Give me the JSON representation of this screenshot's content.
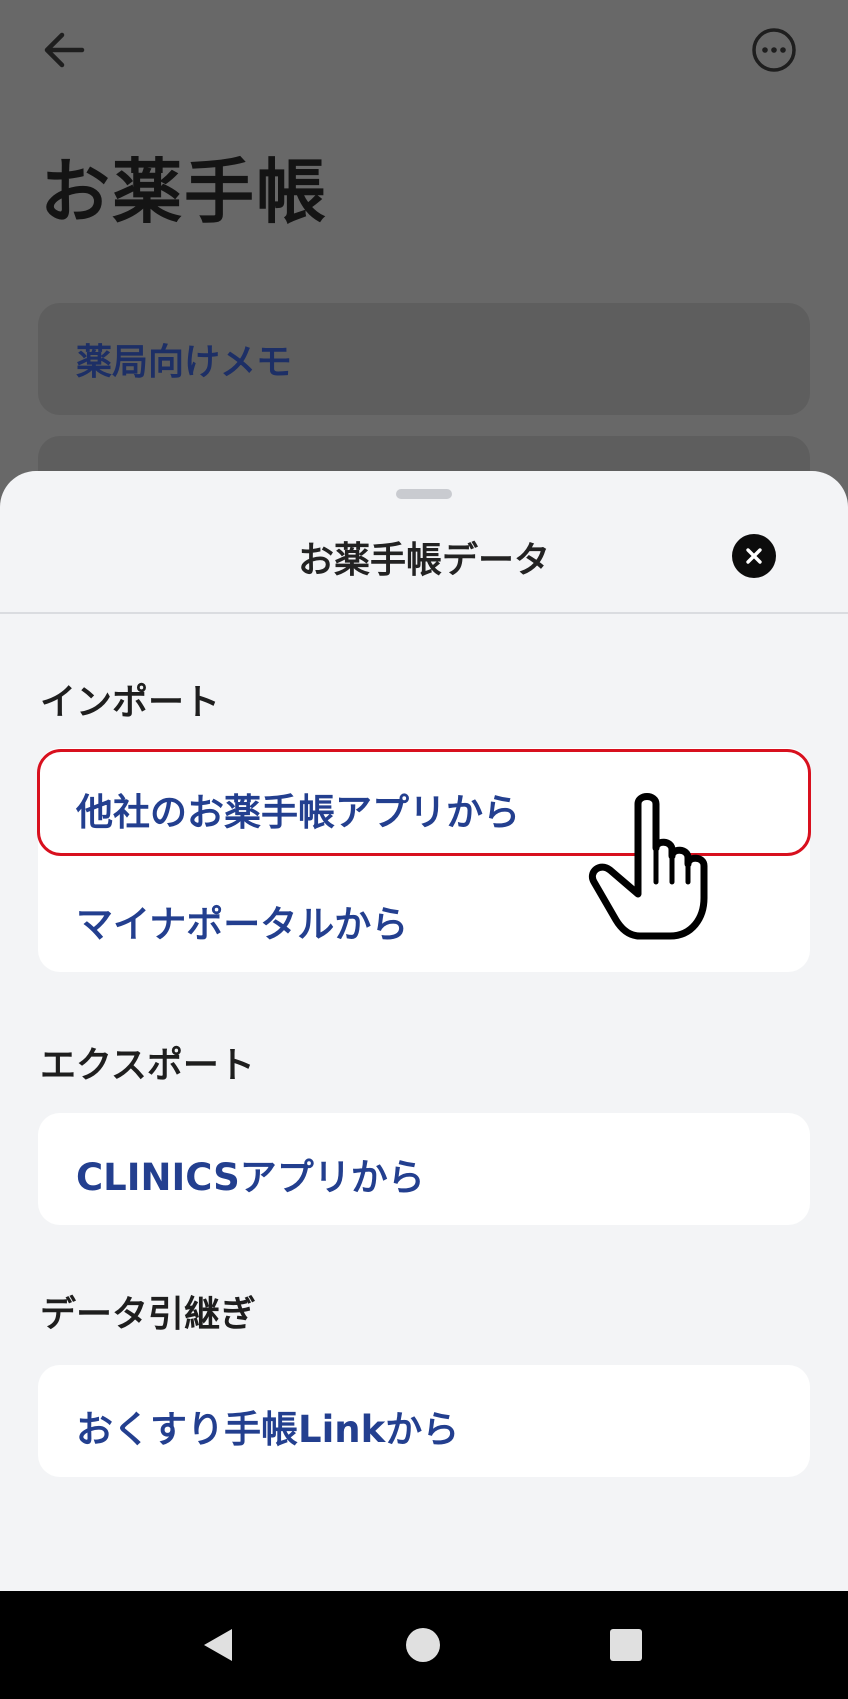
{
  "background": {
    "title": "お薬手帳",
    "cards": [
      "薬局向けメモ",
      ""
    ],
    "icons": {
      "back": "arrow-left-icon",
      "more": "more-horizontal-icon"
    }
  },
  "sheet": {
    "title": "お薬手帳データ",
    "close_icon": "close-circle-icon",
    "sections": {
      "import": {
        "label": "インポート",
        "items": [
          "他社のお薬手帳アプリから",
          "マイナポータルから"
        ]
      },
      "export": {
        "label": "エクスポート",
        "items": [
          "CLINICSアプリから"
        ]
      },
      "transfer": {
        "label": "データ引継ぎ",
        "items": [
          "おくすり手帳Linkから"
        ]
      }
    }
  },
  "colors": {
    "accent_text": "#233f8f",
    "highlight": "#d8101e",
    "sheet_bg": "#f3f4f6"
  },
  "navbar": {
    "icons": [
      "nav-back-icon",
      "nav-home-icon",
      "nav-recents-icon"
    ]
  }
}
